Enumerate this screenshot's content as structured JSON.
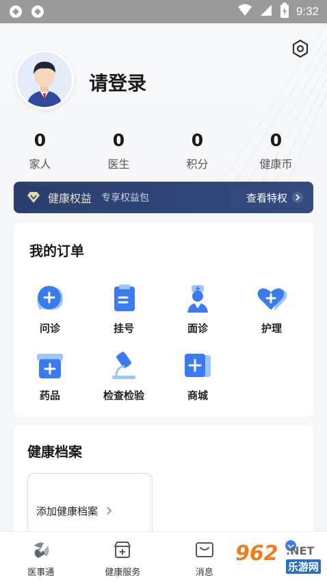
{
  "status_bar": {
    "time": "9:32"
  },
  "profile": {
    "login_text": "请登录"
  },
  "stats": [
    {
      "value": "0",
      "label": "家人"
    },
    {
      "value": "0",
      "label": "医生"
    },
    {
      "value": "0",
      "label": "积分"
    },
    {
      "value": "0",
      "label": "健康币"
    }
  ],
  "rights_banner": {
    "title": "健康权益",
    "subtitle": "专享权益包",
    "link": "查看特权"
  },
  "orders": {
    "title": "我的订单",
    "items": [
      {
        "label": "问诊",
        "icon": "chat-plus-icon"
      },
      {
        "label": "挂号",
        "icon": "clipboard-icon"
      },
      {
        "label": "面诊",
        "icon": "doctor-icon"
      },
      {
        "label": "护理",
        "icon": "heart-plus-icon"
      },
      {
        "label": "药品",
        "icon": "medicine-box-icon"
      },
      {
        "label": "检查检验",
        "icon": "microscope-icon"
      },
      {
        "label": "商城",
        "icon": "shop-plus-icon"
      }
    ]
  },
  "records": {
    "title": "健康档案",
    "add_label": "添加健康档案"
  },
  "bottom_nav": [
    {
      "label": "医事通",
      "icon": "yishitong-logo-icon"
    },
    {
      "label": "健康服务",
      "icon": "gift-box-icon"
    },
    {
      "label": "消息",
      "icon": "message-icon"
    },
    {
      "label": "",
      "icon": "profile-icon"
    }
  ],
  "watermark": {
    "number": "962",
    "net": ".NET",
    "cn": "乐游网"
  },
  "colors": {
    "accent": "#3a7bf0",
    "banner": "#2b3f6e",
    "icon_blue": "#4a8df5"
  }
}
